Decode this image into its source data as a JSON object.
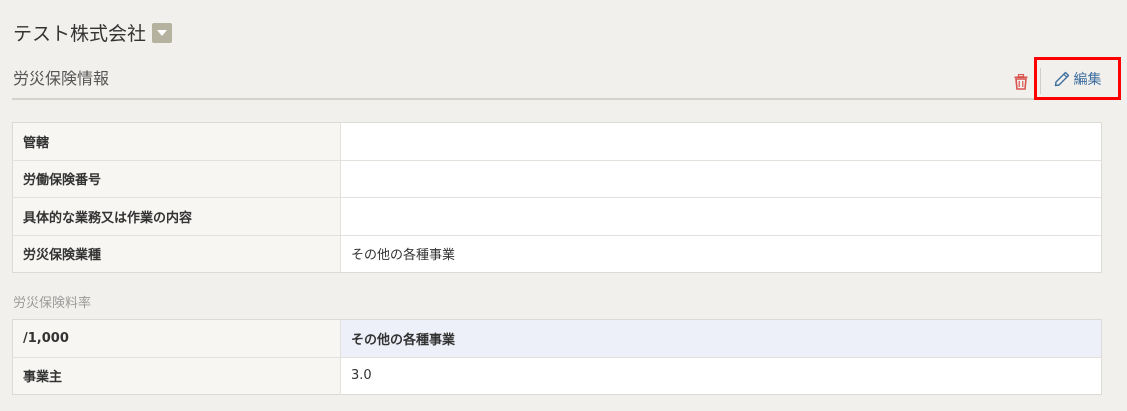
{
  "company": {
    "name": "テスト株式会社",
    "dropdown_icon": "caret-down-icon"
  },
  "section": {
    "title": "労災保険情報"
  },
  "toolbar": {
    "delete_icon": "trash-icon",
    "edit_label": "編集",
    "edit_icon": "pencil-icon",
    "delete_color": "#d9534f",
    "edit_color": "#3d6e9e",
    "highlight_color": "#ff0000"
  },
  "info_table": {
    "rows": [
      {
        "label": "管轄",
        "value": ""
      },
      {
        "label": "労働保険番号",
        "value": ""
      },
      {
        "label": "具体的な業務又は作業の内容",
        "value": ""
      },
      {
        "label": "労災保険業種",
        "value": "その他の各種事業"
      }
    ]
  },
  "rate_section": {
    "caption": "労災保険料率",
    "header": {
      "label": "/1,000",
      "value": "その他の各種事業"
    },
    "rows": [
      {
        "label": "事業主",
        "value": "3.0"
      }
    ]
  }
}
